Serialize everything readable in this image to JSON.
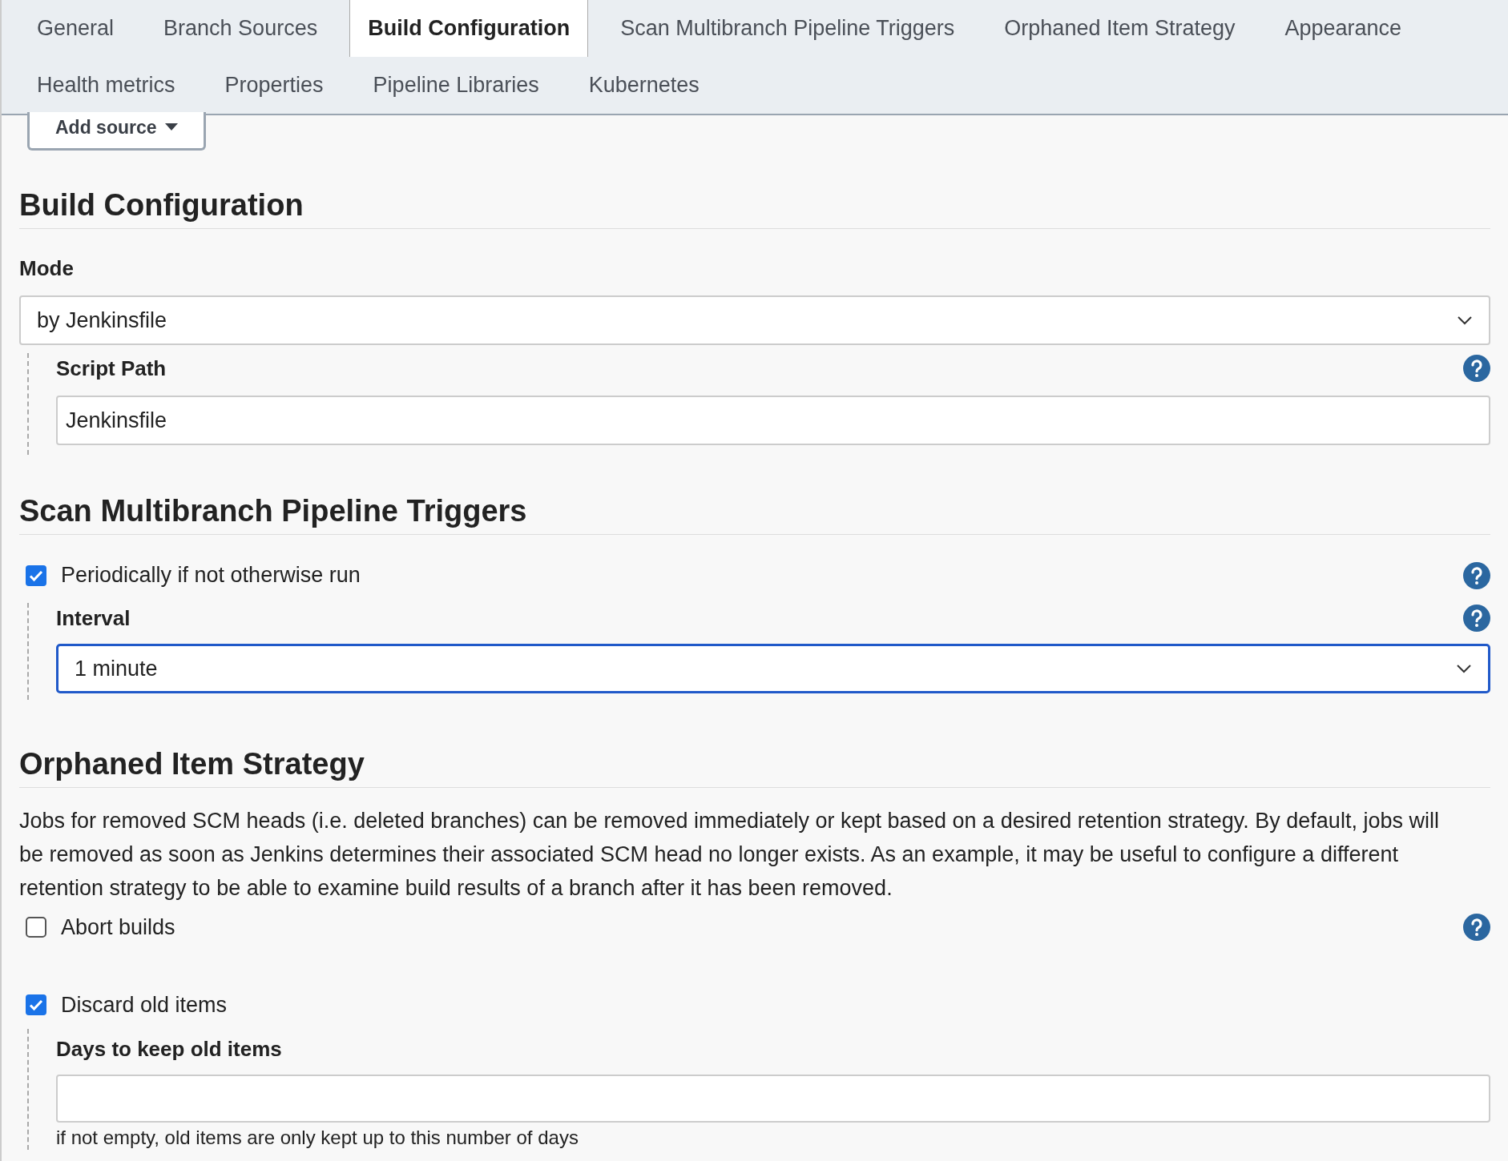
{
  "tabs": [
    {
      "label": "General",
      "selected": false
    },
    {
      "label": "Branch Sources",
      "selected": false
    },
    {
      "label": "Build Configuration",
      "selected": true
    },
    {
      "label": "Scan Multibranch Pipeline Triggers",
      "selected": false
    },
    {
      "label": "Orphaned Item Strategy",
      "selected": false
    },
    {
      "label": "Appearance",
      "selected": false
    },
    {
      "label": "Health metrics",
      "selected": false
    },
    {
      "label": "Properties",
      "selected": false
    },
    {
      "label": "Pipeline Libraries",
      "selected": false
    },
    {
      "label": "Kubernetes",
      "selected": false
    }
  ],
  "add_source_button": "Add source",
  "build_configuration": {
    "title": "Build Configuration",
    "mode_label": "Mode",
    "mode_value": "by Jenkinsfile",
    "script_path_label": "Script Path",
    "script_path_value": "Jenkinsfile"
  },
  "scan_triggers": {
    "title": "Scan Multibranch Pipeline Triggers",
    "periodically": {
      "label": "Periodically if not otherwise run",
      "checked": true
    },
    "interval_label": "Interval",
    "interval_value": "1 minute"
  },
  "orphaned_item_strategy": {
    "title": "Orphaned Item Strategy",
    "description": "Jobs for removed SCM heads (i.e. deleted branches) can be removed immediately or kept based on a desired retention strategy. By default, jobs will be removed as soon as Jenkins determines their associated SCM head no longer exists. As an example, it may be useful to configure a different retention strategy to be able to examine build results of a branch after it has been removed.",
    "abort_builds": {
      "label": "Abort builds",
      "checked": false
    },
    "discard_old_items": {
      "label": "Discard old items",
      "checked": true
    },
    "days_label": "Days to keep old items",
    "days_help": "if not empty, old items are only kept up to this number of days"
  }
}
